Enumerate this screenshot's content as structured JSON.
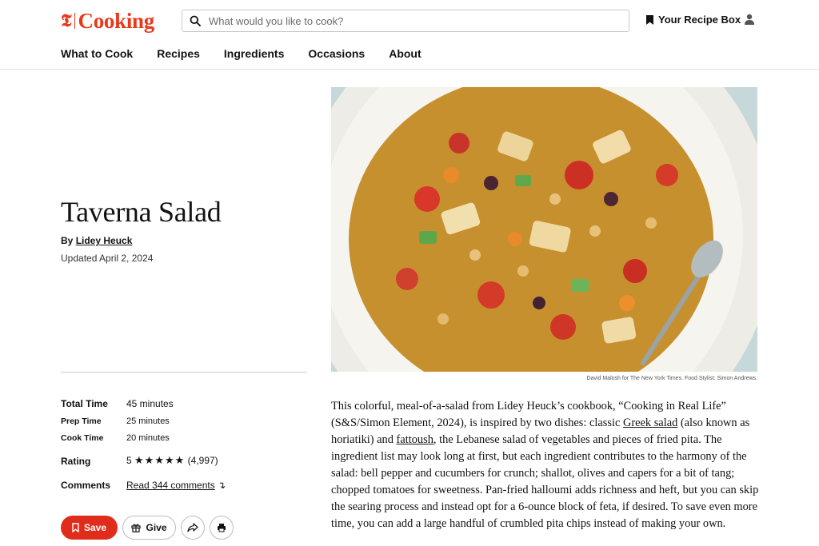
{
  "header": {
    "logo_word": "Cooking",
    "search_placeholder": "What would you like to cook?",
    "recipe_box_label": "Your Recipe Box",
    "nav": [
      "What to Cook",
      "Recipes",
      "Ingredients",
      "Occasions",
      "About"
    ]
  },
  "recipe": {
    "title": "Taverna Salad",
    "by_prefix": "By",
    "author": "Lidey Heuck",
    "updated": "Updated April 2, 2024",
    "stats": {
      "total_time_label": "Total Time",
      "total_time_value": "45 minutes",
      "prep_time_label": "Prep Time",
      "prep_time_value": "25 minutes",
      "cook_time_label": "Cook Time",
      "cook_time_value": "20 minutes",
      "rating_label": "Rating",
      "rating_value": "5",
      "rating_stars": "★★★★★",
      "rating_count": "(4,997)",
      "comments_label": "Comments",
      "comments_link": "Read 344 comments",
      "comments_arrow": "↴"
    },
    "actions": {
      "save_label": "Save",
      "give_label": "Give"
    },
    "photo_credit": "David Malosh for The New York Times. Food Stylist: Simon Andrews.",
    "description": {
      "part1": "This colorful, meal-of-a-salad from Lidey Heuck’s cookbook, “Cooking in Real Life” (S&S/Simon Element, 2024), is inspired by two dishes: classic ",
      "link1": "Greek salad",
      "part2": " (also known as horiatiki) and ",
      "link2": "fattoush",
      "part3": ", the Lebanese salad of vegetables and pieces of fried pita. The ingredient list may look long at first, but each ingredient contributes to the harmony of the salad: bell pepper and cucumbers for crunch; shallot, olives and capers for a bit of tang; chopped tomatoes for sweetness. Pan-fried halloumi adds richness and heft, but you can skip the searing process and instead opt for a 6-ounce block of feta, if desired. To save even more time, you can add a large handful of crumbled pita chips instead of making your own."
    }
  },
  "colors": {
    "brand_red": "#e9391a",
    "save_button": "#e02d1b"
  }
}
